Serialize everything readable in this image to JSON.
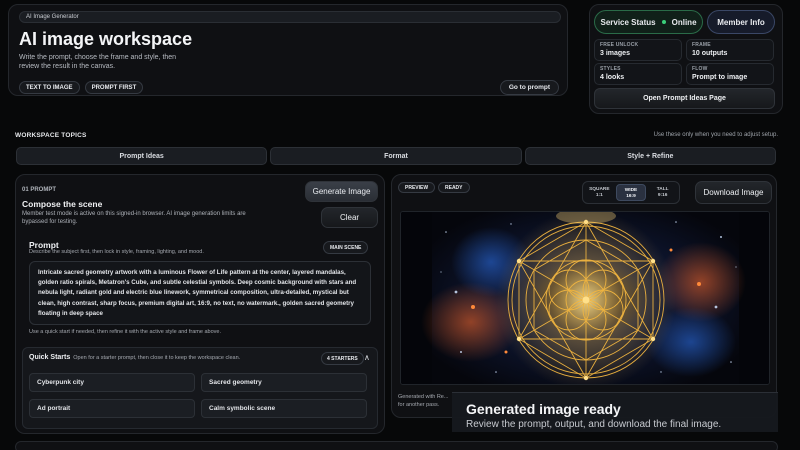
{
  "hero": {
    "tag": "AI Image Generator",
    "title": "AI image workspace",
    "description": "Write the prompt, choose the frame and style, then review the result in the canvas.",
    "pills": [
      "TEXT TO IMAGE",
      "PROMPT FIRST"
    ],
    "goto_label": "Go to prompt"
  },
  "side": {
    "status_label": "Service Status",
    "status_value": "Online",
    "member_label": "Member Info",
    "stats": [
      {
        "k": "FREE UNLOCK",
        "v": "3 images"
      },
      {
        "k": "FRAME",
        "v": "10 outputs"
      },
      {
        "k": "STYLES",
        "v": "4 looks"
      },
      {
        "k": "FLOW",
        "v": "Prompt to image"
      }
    ],
    "ideas_label": "Open Prompt Ideas Page"
  },
  "workspace": {
    "title": "WORKSPACE TOPICS",
    "note": "Use these only when you need to adjust setup.",
    "tabs": [
      "Prompt Ideas",
      "Format",
      "Style + Refine"
    ]
  },
  "composer": {
    "step": "01 PROMPT",
    "title": "Compose the scene",
    "desc": "Member test mode is active on this signed-in browser. AI image generation limits are bypassed for testing.",
    "generate_label": "Generate Image",
    "clear_label": "Clear",
    "prompt_title": "Prompt",
    "prompt_desc": "Describe the subject first, then lock in style, framing, lighting, and mood.",
    "main_scene": "MAIN SCENE",
    "prompt_text": "Intricate sacred geometry artwork with a luminous Flower of Life pattern at the center, layered mandalas, golden ratio spirals, Metatron's Cube, and subtle celestial symbols. Deep cosmic background with stars and nebula light, radiant gold and electric blue linework, symmetrical composition, ultra-detailed, mystical but clean, high contrast, sharp focus, premium digital art, 16:9, no text, no watermark., golden sacred geometry floating in deep space",
    "hint": "Use a quick start if needed, then refine it with the active style and frame above.",
    "quick": {
      "title": "Quick Starts",
      "sub": "Open for a starter prompt, then close it to keep the workspace clean.",
      "count": "4 STARTERS",
      "items": [
        "Cyberpunk city",
        "Sacred geometry",
        "Ad portrait",
        "Calm symbolic scene"
      ]
    }
  },
  "preview": {
    "pills": [
      "PREVIEW",
      "READY"
    ],
    "ratios": [
      {
        "name": "SQUARE",
        "ratio": "1:1",
        "active": false
      },
      {
        "name": "WIDE",
        "ratio": "16:9",
        "active": true
      },
      {
        "name": "TALL",
        "ratio": "9:16",
        "active": false
      }
    ],
    "download_label": "Download Image",
    "gen_note": "Generated with Re... for another pass."
  },
  "toast": {
    "title": "Generated image ready",
    "subtitle": "Review the prompt, output, and download the final image."
  },
  "colors": {
    "accent_green": "#3ad07a",
    "gold": "#f2b640",
    "electric_blue": "#2f7bff"
  }
}
